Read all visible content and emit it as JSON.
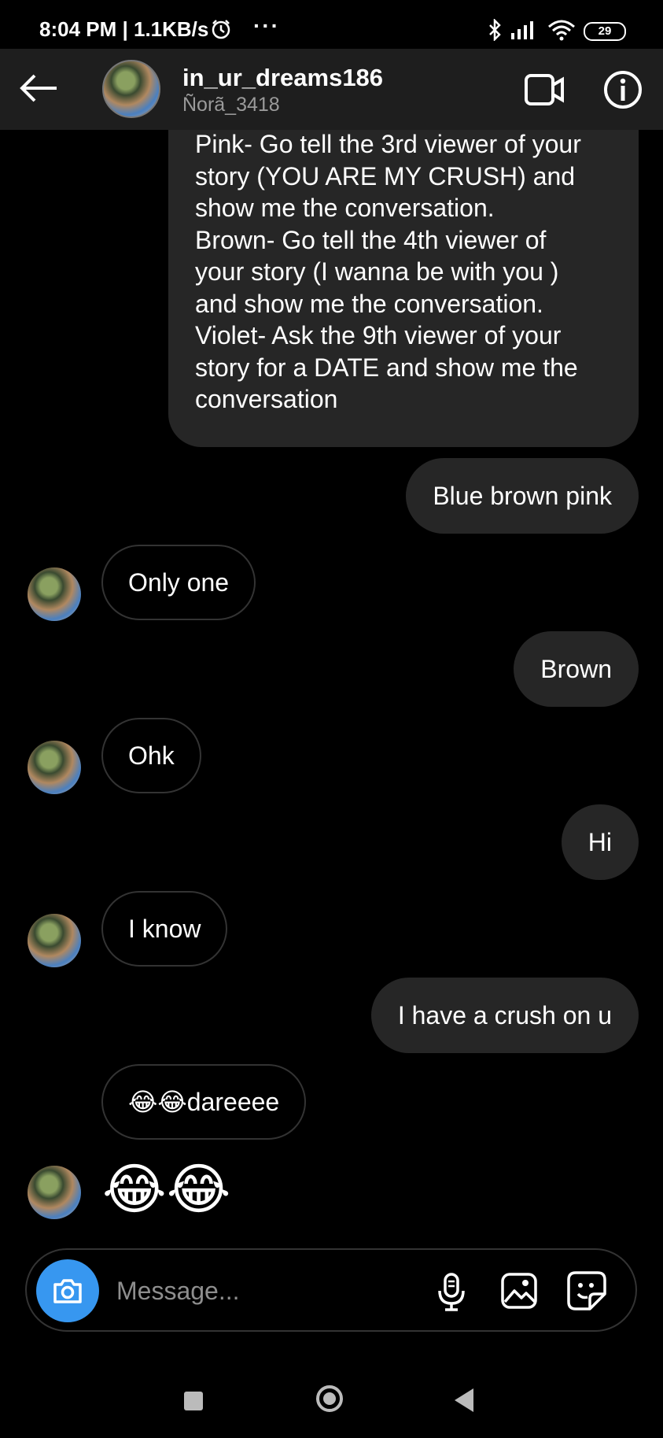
{
  "status_bar": {
    "time": "8:04 PM | 1.1KB/s",
    "more": "···",
    "battery": "29",
    "icons": [
      "alarm-icon",
      "bluetooth-icon",
      "signal-icon",
      "wifi-icon",
      "battery-icon"
    ]
  },
  "header": {
    "username": "in_ur_dreams186",
    "display_name": "Ñorã_3418",
    "icons": [
      "back-arrow-icon",
      "video-call-icon",
      "info-icon"
    ]
  },
  "conversation": {
    "long_message_lines": [
      "Pink- Go tell the 3rd viewer of your",
      "story (YOU ARE MY CRUSH) and",
      "show me the conversation.",
      "Brown- Go tell the 4th viewer of",
      "your story (I wanna be with you )",
      "and show me the conversation.",
      "Violet- Ask the 9th viewer of your",
      "story for a DATE and show me the",
      "conversation"
    ],
    "messages": [
      {
        "from": "me",
        "text": "Blue brown pink"
      },
      {
        "from": "them",
        "text": "Only one"
      },
      {
        "from": "me",
        "text": "Brown"
      },
      {
        "from": "them",
        "text": "Ohk"
      },
      {
        "from": "me",
        "text": "Hi"
      },
      {
        "from": "them",
        "text": "I know"
      },
      {
        "from": "me",
        "text": "I have a crush on u"
      },
      {
        "from": "them",
        "text": "😂😂dareeee"
      },
      {
        "from": "them",
        "text": "😂😂"
      }
    ]
  },
  "composer": {
    "placeholder": "Message...",
    "icons": [
      "camera-icon",
      "microphone-icon",
      "gallery-icon",
      "sticker-icon"
    ]
  },
  "nav_bar": {
    "icons": [
      "recents-icon",
      "home-icon",
      "back-icon"
    ]
  }
}
